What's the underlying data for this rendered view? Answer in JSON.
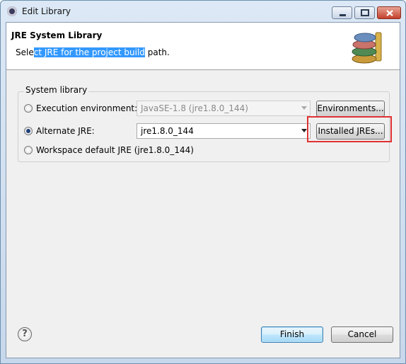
{
  "window": {
    "title": "Edit Library",
    "controls": {
      "minimize": "minimize-icon",
      "maximize": "maximize-icon",
      "close": "close-icon"
    }
  },
  "header": {
    "title": "JRE System Library",
    "message_prefix": "Sele",
    "message_selected": "ct JRE for the project build",
    "message_suffix": " path.",
    "art_icon": "library-books-icon"
  },
  "group": {
    "label": "System library",
    "options": [
      {
        "label": "Execution environment:",
        "checked": false
      },
      {
        "label": "Alternate JRE:",
        "checked": true
      },
      {
        "label": "Workspace default JRE (jre1.8.0_144)",
        "checked": false
      }
    ],
    "execution_environment_value": "JavaSE-1.8 (jre1.8.0_144)",
    "alternate_jre_value": "jre1.8.0_144",
    "environments_button": "Environments...",
    "installed_jres_button": "Installed JREs..."
  },
  "footer": {
    "help_icon": "help-icon",
    "help_glyph": "?",
    "finish_button": "Finish",
    "cancel_button": "Cancel"
  },
  "colors": {
    "selection": "#3399ff",
    "highlight_box": "#e03232"
  }
}
